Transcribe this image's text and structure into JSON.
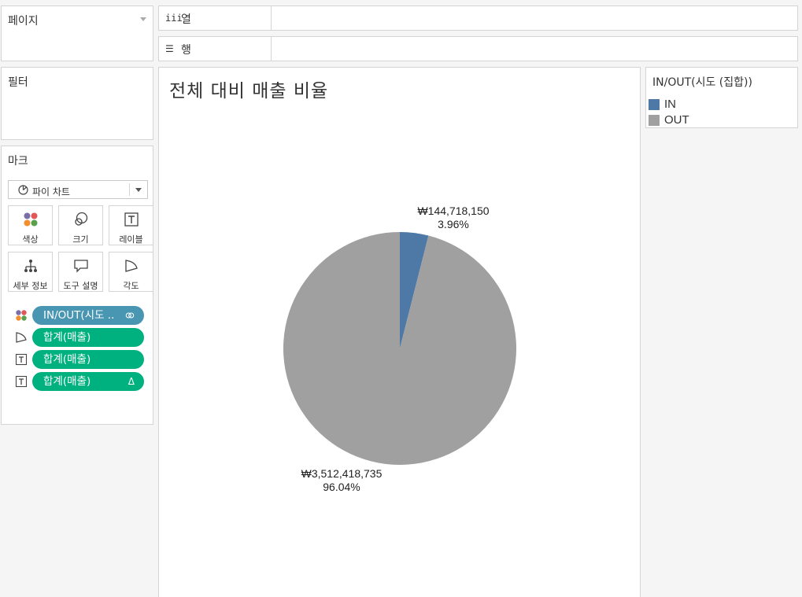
{
  "left_panel": {
    "pages_title": "페이지",
    "filters_title": "필터",
    "marks_title": "마크",
    "mark_type": "파이 차트",
    "mark_buttons": [
      {
        "label": "색상",
        "icon": "color-icon"
      },
      {
        "label": "크기",
        "icon": "size-icon"
      },
      {
        "label": "레이블",
        "icon": "label-icon"
      },
      {
        "label": "세부 정보",
        "icon": "detail-icon"
      },
      {
        "label": "도구 설명",
        "icon": "tooltip-icon"
      },
      {
        "label": "각도",
        "icon": "angle-icon"
      }
    ],
    "mark_pills": [
      {
        "label": "IN/OUT(시도 ..",
        "type_icon": "color-icon",
        "suffix_icon": "link-icon",
        "color": "#4996b2"
      },
      {
        "label": "합계(매출)",
        "type_icon": "angle-icon",
        "color": "#00b180"
      },
      {
        "label": "합계(매출)",
        "type_icon": "label-icon",
        "color": "#00b180"
      },
      {
        "label": "합계(매출)",
        "type_icon": "label-icon",
        "suffix": "Δ",
        "color": "#00b180"
      }
    ]
  },
  "shelves": {
    "columns_label": "열",
    "columns_icon": "iii",
    "rows_label": "행",
    "rows_icon": "☰"
  },
  "sheet": {
    "title": "전체 대비 매출 비율"
  },
  "legend": {
    "title": "IN/OUT(시도 (집합))",
    "items": [
      {
        "label": "IN",
        "color": "#4e79a7"
      },
      {
        "label": "OUT",
        "color": "#a0a0a0"
      }
    ]
  },
  "chart_data": {
    "type": "pie",
    "categories": [
      "IN",
      "OUT"
    ],
    "values": [
      144718150,
      3512418735
    ],
    "value_labels": [
      "₩144,718,150",
      "₩3,512,418,735"
    ],
    "percent_labels": [
      "3.96%",
      "96.04%"
    ],
    "colors": [
      "#4e79a7",
      "#a0a0a0"
    ],
    "title": "전체 대비 매출 비율"
  }
}
